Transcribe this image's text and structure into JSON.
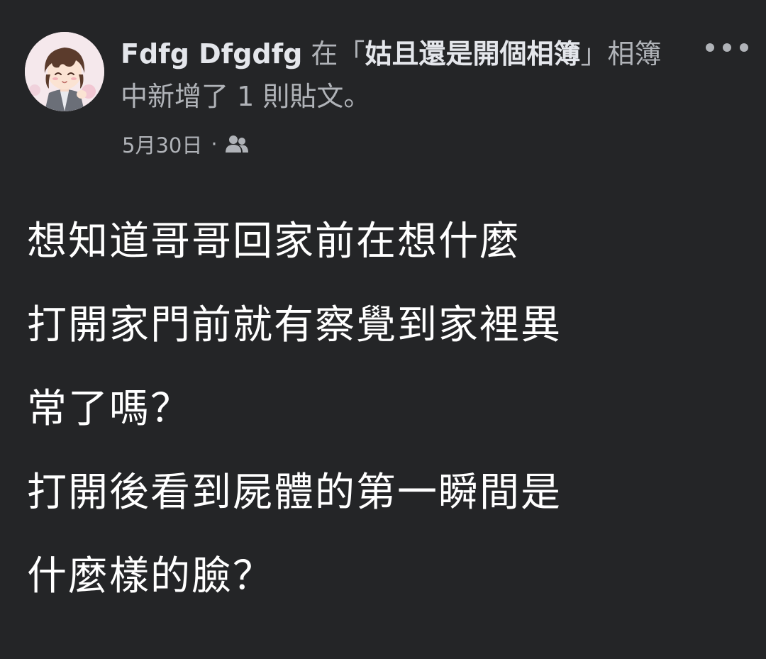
{
  "post": {
    "author": "Fdfg Dfgdfg",
    "action_prefix": " 在「",
    "album_name": "姑且還是開個相簿",
    "action_suffix": "」相簿中新增了 1 則貼文。",
    "date": "5月30日",
    "separator": "·",
    "privacy_icon": "friends-icon",
    "more_icon": "more-dots-icon",
    "body_lines": [
      "想知道哥哥回家前在想什麼",
      "打開家門前就有察覺到家裡異",
      "常了嗎？",
      "打開後看到屍體的第一瞬間是",
      "什麼樣的臉？"
    ]
  },
  "colors": {
    "background": "#242527",
    "primary_text": "#e4e6eb",
    "secondary_text": "#b0b3b8",
    "body_text": "#ffffff"
  }
}
